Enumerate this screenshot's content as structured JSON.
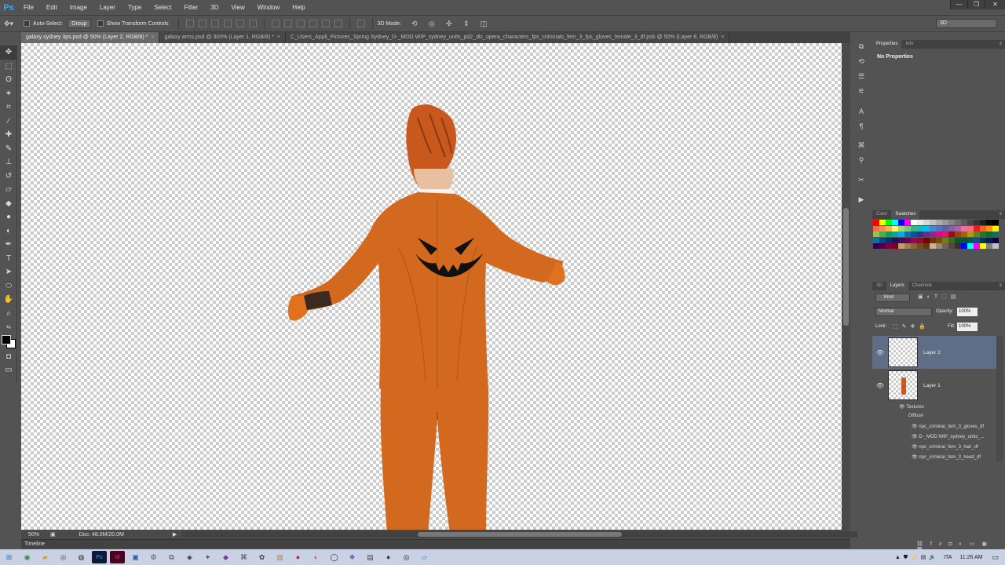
{
  "app": {
    "logo": "Ps"
  },
  "menu": [
    "File",
    "Edit",
    "Image",
    "Layer",
    "Type",
    "Select",
    "Filter",
    "3D",
    "View",
    "Window",
    "Help"
  ],
  "window_controls": {
    "minimize": "—",
    "restore": "❐",
    "close": "✕"
  },
  "options_bar": {
    "auto_select_label": "Auto-Select:",
    "auto_select_value": "Group",
    "transform_label": "Show Transform Controls",
    "mode_3d_label": "3D Mode:",
    "workspace": "3D"
  },
  "tabs": [
    {
      "label": "galaxy sydney 3ps.psd @ 50% (Layer 2, RGB/8) *",
      "close": "×"
    },
    {
      "label": "galaxy arms.psd @ 300% (Layer 1, RGB/8) *",
      "close": "×"
    },
    {
      "label": "C_Users_Appli_Pictures_Spring Sydney_D-_MOD WIP_sydney_units_pd2_dlc_opera_characters_fps_criminals_fem_3_fps_gloves_female_3_df.psb @ 50% (Layer 8, RGB/8)",
      "close": "×"
    }
  ],
  "status": {
    "zoom": "50%",
    "doc": "Doc: 48.0M/20.0M"
  },
  "timeline_label": "Timeline",
  "properties_panel": {
    "tabs": [
      "Properties",
      "Info"
    ],
    "content": "No Properties"
  },
  "color_panel": {
    "tabs": [
      "Color",
      "Swatches"
    ]
  },
  "swatches": [
    "#ff0000",
    "#ffff00",
    "#00ff00",
    "#00ffff",
    "#0000ff",
    "#ff00ff",
    "#ffffff",
    "#ebebeb",
    "#d6d6d6",
    "#c2c2c2",
    "#adadad",
    "#999999",
    "#858585",
    "#707070",
    "#5c5c5c",
    "#474747",
    "#333333",
    "#1f1f1f",
    "#0a0a0a",
    "#000000",
    "#f26c4f",
    "#f68e55",
    "#fbaf5c",
    "#fff467",
    "#acd372",
    "#7cc576",
    "#3bb878",
    "#1abbb4",
    "#00bff3",
    "#438cca",
    "#5574b9",
    "#605ca8",
    "#855fa8",
    "#a763a8",
    "#f06ea9",
    "#f26d7d",
    "#ed1c24",
    "#f26522",
    "#f7941d",
    "#fff200",
    "#8dc73f",
    "#39b54a",
    "#00a651",
    "#00a99d",
    "#00aeef",
    "#0072bc",
    "#0054a6",
    "#2e3192",
    "#662d91",
    "#92278f",
    "#ec008c",
    "#ed145b",
    "#9e0b0f",
    "#a0410d",
    "#a3620a",
    "#aba000",
    "#598527",
    "#197b30",
    "#007236",
    "#00746b",
    "#0076a3",
    "#004b80",
    "#003471",
    "#1b1464",
    "#440e62",
    "#630460",
    "#9e005d",
    "#9e0039",
    "#790000",
    "#7b2e00",
    "#7d4900",
    "#827b00",
    "#406618",
    "#005e20",
    "#005826",
    "#005952",
    "#005b7f",
    "#003663",
    "#002157",
    "#0d004c",
    "#32004b",
    "#4b0049",
    "#7b0046",
    "#7a0026",
    "#c69c6d",
    "#a67c52",
    "#8c6239",
    "#754c24",
    "#603813",
    "#c7b299",
    "#998675",
    "#736357",
    "#534741",
    "#362f2d",
    "#0000ff",
    "#00ffff",
    "#ff00ff",
    "#ffff00",
    "#808080",
    "#c0c0c0"
  ],
  "layers_panel": {
    "tabs": [
      "3D",
      "Layers",
      "Channels"
    ],
    "kind": "Kind",
    "blend_mode": "Normal",
    "opacity_label": "Opacity:",
    "opacity": "100%",
    "lock_label": "Lock:",
    "fill_label": "Fill:",
    "fill": "100%",
    "layers": [
      {
        "name": "Layer 2",
        "selected": true
      },
      {
        "name": "Layer 1",
        "selected": false
      }
    ],
    "textures_label": "Textures",
    "diffuse_label": "Diffuse",
    "textures": [
      "npc_criminal_fem_3_gloves_df",
      "D-_MOD WIP_sydney_units_...",
      "npc_criminal_fem_3_hair_df",
      "npc_criminal_fem_3_head_df"
    ]
  },
  "tray": {
    "lang": "ITA",
    "time": "11:26 AM"
  }
}
